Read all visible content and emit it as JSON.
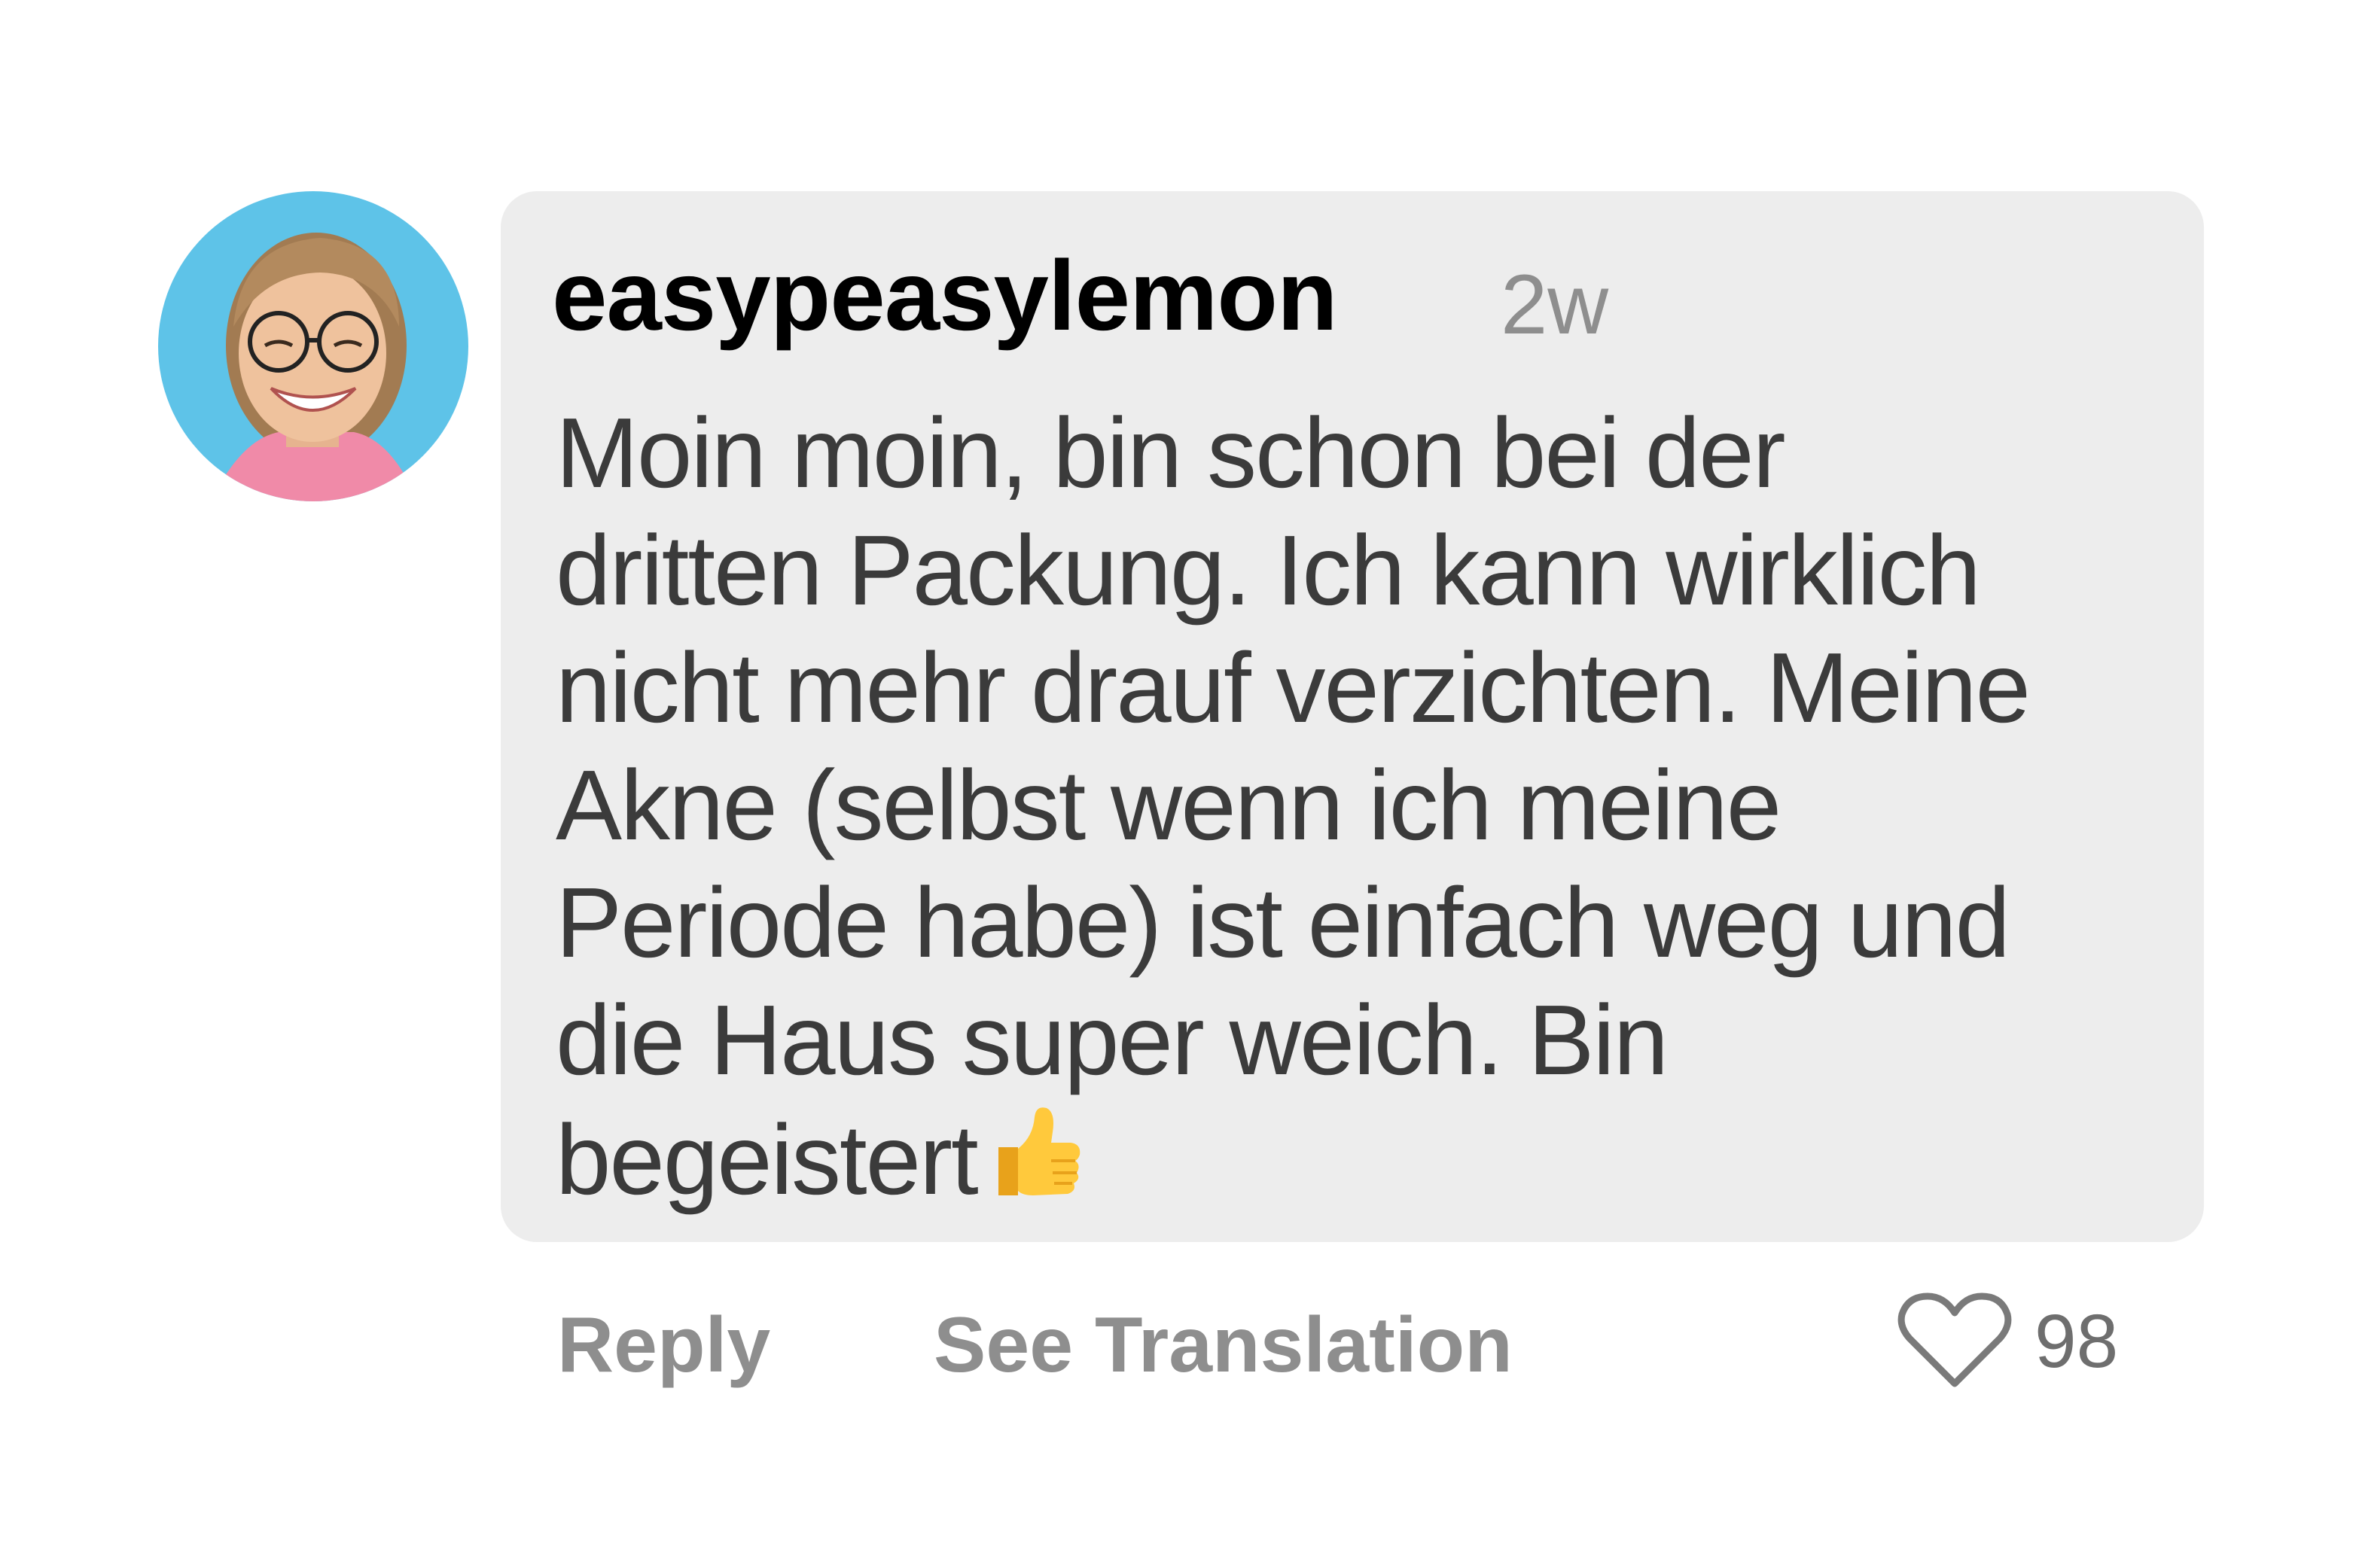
{
  "comment": {
    "username": "easypeasylemon",
    "timestamp": "2w",
    "lines": [
      "Moin moin, bin schon bei der",
      "dritten Packung. Ich kann wirklich",
      "nicht mehr drauf verzichten. Meine",
      "Akne (selbst wenn ich meine",
      "Periode habe) ist einfach weg und",
      "die Haus super weich. Bin",
      "begeistert"
    ],
    "emoji": "thumbs-up-emoji"
  },
  "actions": {
    "reply_label": "Reply",
    "translate_label": "See Translation",
    "like_icon": "heart-icon",
    "like_count": "98"
  },
  "colors": {
    "bubble_bg": "#ededed",
    "username": "#000000",
    "body_text": "#3b3b3b",
    "muted": "#8e8e8e",
    "avatar_bg": "#5ec3e8"
  }
}
